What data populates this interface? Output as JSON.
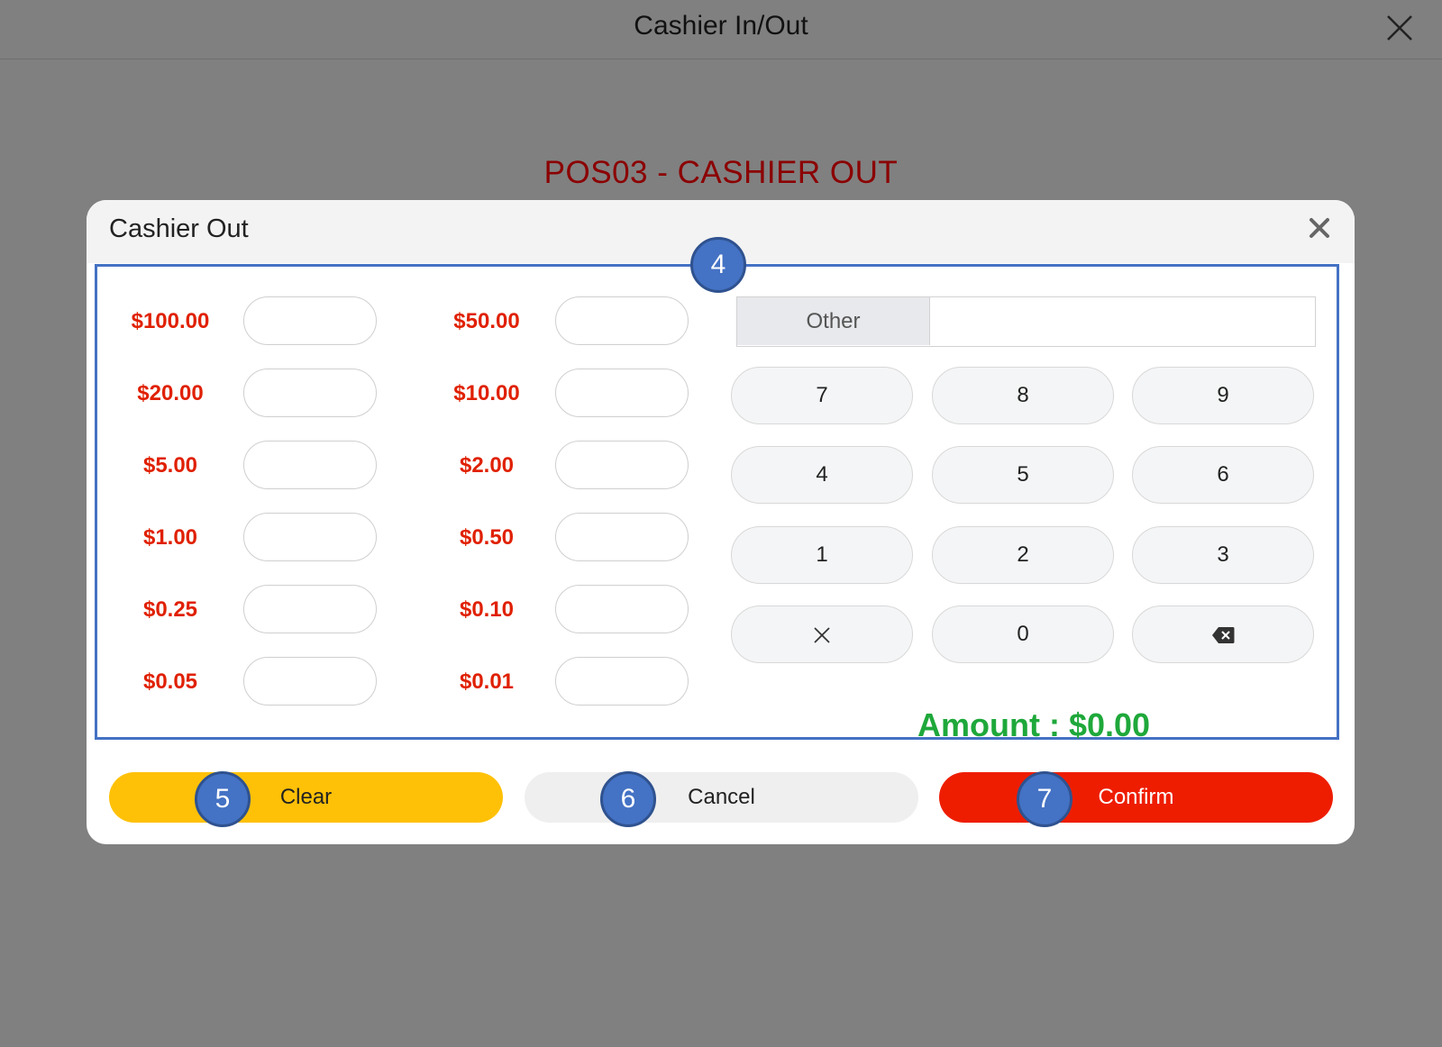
{
  "window": {
    "title": "Cashier In/Out",
    "close_icon": "close-icon"
  },
  "page": {
    "heading": "POS03 - CASHIER OUT"
  },
  "modal": {
    "title": "Cashier Out",
    "close_icon": "close-icon",
    "denominations": [
      {
        "left_label": "$100.00",
        "right_label": "$50.00"
      },
      {
        "left_label": "$20.00",
        "right_label": "$10.00"
      },
      {
        "left_label": "$5.00",
        "right_label": "$2.00"
      },
      {
        "left_label": "$1.00",
        "right_label": "$0.50"
      },
      {
        "left_label": "$0.25",
        "right_label": "$0.10"
      },
      {
        "left_label": "$0.05",
        "right_label": "$0.01"
      }
    ],
    "other": {
      "label": "Other",
      "value": ""
    },
    "keypad": {
      "keys": [
        "7",
        "8",
        "9",
        "4",
        "5",
        "6",
        "1",
        "2",
        "3"
      ],
      "clear_icon": "x-icon",
      "zero": "0",
      "backspace_icon": "backspace-icon"
    },
    "amount": {
      "label": "Amount : ",
      "value": "$0.00"
    },
    "buttons": {
      "clear": "Clear",
      "cancel": "Cancel",
      "confirm": "Confirm"
    }
  },
  "markers": [
    "4",
    "5",
    "6",
    "7"
  ],
  "colors": {
    "denomination_text": "#e02000",
    "amount_text": "#1ea83a",
    "clear_button": "#ffc107",
    "confirm_button": "#ee1d00",
    "heading_text": "#8b0000",
    "marker": "#4472c4"
  }
}
